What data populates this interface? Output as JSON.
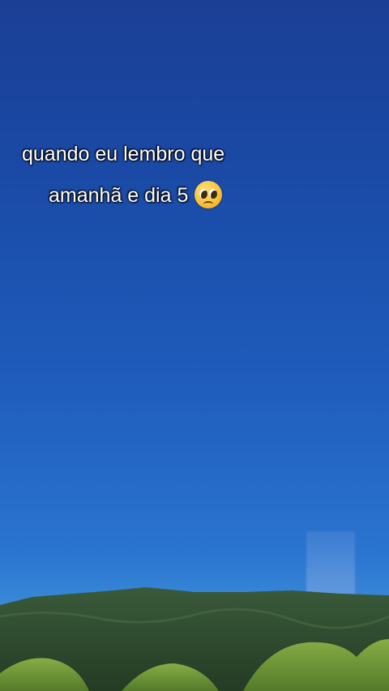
{
  "caption": {
    "line1": "quando eu lembro que",
    "line2": "amanhã e dia 5"
  },
  "emoji": "pleading-face-icon",
  "colors": {
    "sky_top": "#1b3f95",
    "sky_bottom": "#3a8ad8",
    "forest": "#2d4a2c",
    "hills": "#6f9a3a"
  }
}
